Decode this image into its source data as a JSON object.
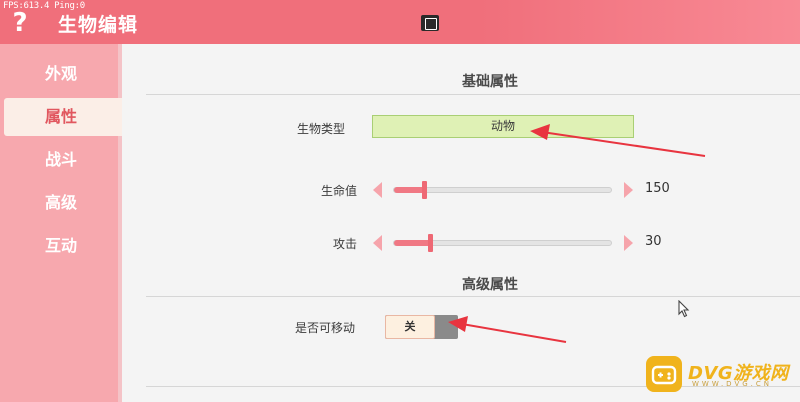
{
  "topbar": {
    "fps_text": "FPS:613.4  Ping:0",
    "help_glyph": "?",
    "title": "生物编辑"
  },
  "sidebar": {
    "items": [
      {
        "label": "外观",
        "active": false
      },
      {
        "label": "属性",
        "active": true
      },
      {
        "label": "战斗",
        "active": false
      },
      {
        "label": "高级",
        "active": false
      },
      {
        "label": "互动",
        "active": false
      }
    ]
  },
  "basic": {
    "section_title": "基础属性",
    "creature_type_label": "生物类型",
    "creature_type_value": "动物",
    "health": {
      "label": "生命值",
      "value": "150",
      "fill_fraction": 0.14
    },
    "attack": {
      "label": "攻击",
      "value": "30",
      "fill_fraction": 0.17
    }
  },
  "advanced": {
    "section_title": "高级属性",
    "movable_label": "是否可移动",
    "movable_value": "关"
  },
  "colors": {
    "topbar": "#f06f7b",
    "sidebar": "#f7a8ae",
    "active_tab_text": "#e1575f",
    "slider_fill": "#f07884",
    "type_field_bg": "#dff1b5",
    "annotation_arrow": "#e8343f"
  },
  "watermark": {
    "brand": "DVG游戏网",
    "sub": "WWW.DVG.CN"
  }
}
